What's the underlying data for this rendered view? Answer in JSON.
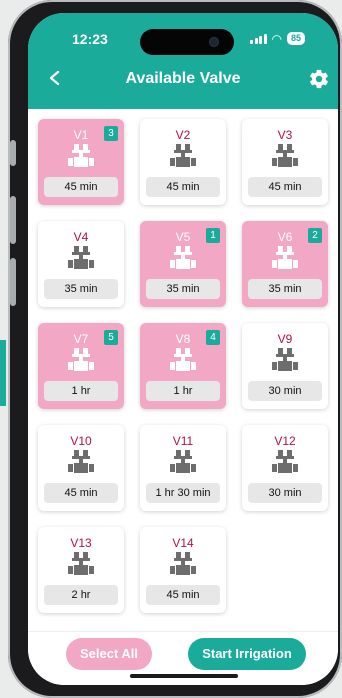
{
  "status_bar": {
    "time": "12:23",
    "battery": "85"
  },
  "header": {
    "title": "Available Valve"
  },
  "colors": {
    "accent": "#1aab9b",
    "active_card": "#f2a7c4",
    "valve_label": "#b3123e",
    "icon_gray": "#6d6d6d"
  },
  "valves": [
    {
      "label": "V1",
      "duration": "45 min",
      "active": true,
      "order": "3"
    },
    {
      "label": "V2",
      "duration": "45 min",
      "active": false,
      "order": ""
    },
    {
      "label": "V3",
      "duration": "45 min",
      "active": false,
      "order": ""
    },
    {
      "label": "V4",
      "duration": "35 min",
      "active": false,
      "order": ""
    },
    {
      "label": "V5",
      "duration": "35 min",
      "active": true,
      "order": "1"
    },
    {
      "label": "V6",
      "duration": "35 min",
      "active": true,
      "order": "2"
    },
    {
      "label": "V7",
      "duration": "1 hr",
      "active": true,
      "order": "5"
    },
    {
      "label": "V8",
      "duration": "1 hr",
      "active": true,
      "order": "4"
    },
    {
      "label": "V9",
      "duration": "30 min",
      "active": false,
      "order": ""
    },
    {
      "label": "V10",
      "duration": "45 min",
      "active": false,
      "order": ""
    },
    {
      "label": "V11",
      "duration": "1 hr 30 min",
      "active": false,
      "order": ""
    },
    {
      "label": "V12",
      "duration": "30 min",
      "active": false,
      "order": ""
    },
    {
      "label": "V13",
      "duration": "2 hr",
      "active": false,
      "order": ""
    },
    {
      "label": "V14",
      "duration": "45 min",
      "active": false,
      "order": ""
    }
  ],
  "actions": {
    "select_all": "Select All",
    "start_irrigation": "Start Irrigation"
  }
}
